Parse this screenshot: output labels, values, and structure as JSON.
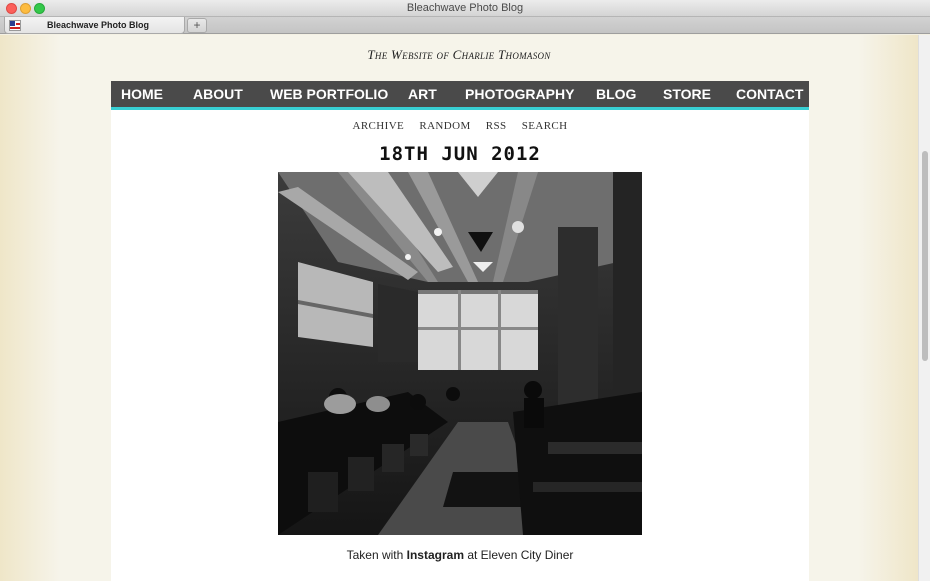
{
  "window": {
    "title": "Bleachwave Photo Blog",
    "tab_title": "Bleachwave Photo Blog",
    "new_tab_symbol": "+"
  },
  "site": {
    "title": "The Website of Charlie Thomason"
  },
  "main_nav": [
    {
      "label": "HOME"
    },
    {
      "label": "ABOUT"
    },
    {
      "label": "WEB PORTFOLIO"
    },
    {
      "label": "ART"
    },
    {
      "label": "PHOTOGRAPHY"
    },
    {
      "label": "BLOG"
    },
    {
      "label": "STORE"
    },
    {
      "label": "CONTACT"
    }
  ],
  "sub_nav": [
    {
      "label": "ARCHIVE"
    },
    {
      "label": "RANDOM"
    },
    {
      "label": "RSS"
    },
    {
      "label": "SEARCH"
    }
  ],
  "post": {
    "date": "18TH JUN 2012",
    "caption_prefix": "Taken with ",
    "caption_app": "Instagram",
    "caption_suffix": " at Eleven City Diner"
  },
  "colors": {
    "nav_bg": "#4a4a4a",
    "nav_accent": "#38cfd3",
    "page_bg": "#f6f4ea"
  }
}
